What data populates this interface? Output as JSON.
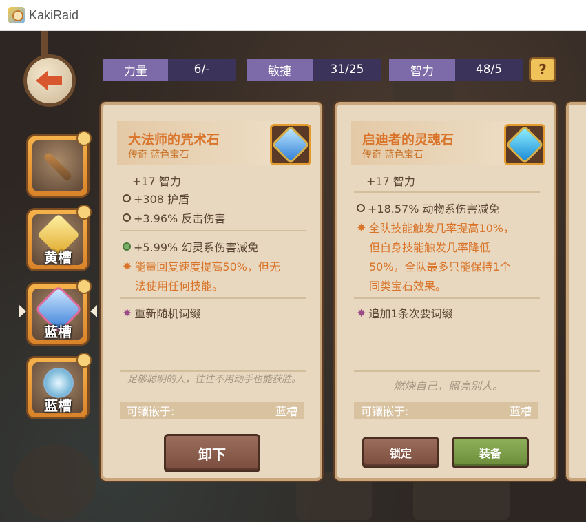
{
  "window": {
    "title": "KakiRaid"
  },
  "stats": [
    {
      "label": "力量",
      "value": "6/-"
    },
    {
      "label": "敏捷",
      "value": "31/25"
    },
    {
      "label": "智力",
      "value": "48/5"
    }
  ],
  "help": {
    "label": "?"
  },
  "slots": [
    {
      "label": "",
      "icon": "crossbow-icon"
    },
    {
      "label": "黄槽",
      "icon": "yellow-gem-icon"
    },
    {
      "label": "蓝槽",
      "icon": "blue-gem-icon",
      "selected": true
    },
    {
      "label": "蓝槽",
      "icon": "bubble-gem-icon"
    }
  ],
  "cards": [
    {
      "name": "大法师的咒术石",
      "subtitle": "传奇 蓝色宝石",
      "primary": "+17 智力",
      "stats": [
        "+308 护盾",
        "+3.96% 反击伤害"
      ],
      "bonus": "+5.99% 幻灵系伤害减免",
      "effect_lines": [
        "能量回复速度提高50%，但无",
        "法使用任何技能。"
      ],
      "affix": "重新随机词缀",
      "flavor": "足够聪明的人，往往不用动手也能获胜。",
      "socket_label": "可镶嵌于:",
      "socket_value": "蓝槽",
      "buttons": [
        "卸下"
      ]
    },
    {
      "name": "启迪者的灵魂石",
      "subtitle": "传奇 蓝色宝石",
      "primary": "+17 智力",
      "stats": [
        "+18.57% 动物系伤害减免"
      ],
      "effect_lines": [
        "全队技能触发几率提高10%，",
        "但自身技能触发几率降低",
        "50%，全队最多只能保持1个",
        "同类宝石效果。"
      ],
      "affix": "追加1条次要词缀",
      "flavor": "燃烧自己，照亮别人。",
      "socket_label": "可镶嵌于:",
      "socket_value": "蓝槽",
      "buttons": [
        "锁定",
        "装备"
      ]
    }
  ]
}
